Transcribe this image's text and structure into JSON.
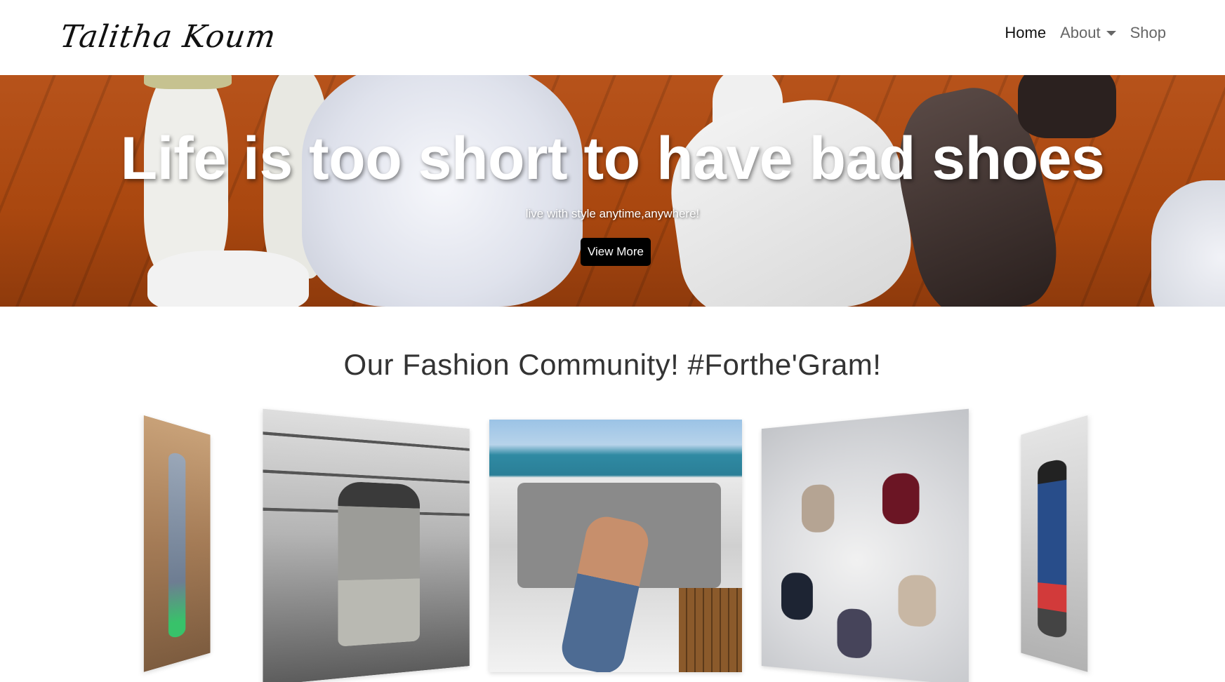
{
  "navbar": {
    "brand": "Talitha Koum",
    "links": [
      {
        "label": "Home",
        "active": true
      },
      {
        "label": "About",
        "has_dropdown": true
      },
      {
        "label": "Shop"
      }
    ]
  },
  "hero": {
    "title": "Life is too short to have bad shoes",
    "subtitle": "live with style anytime,anywhere!",
    "button_label": "View More"
  },
  "community": {
    "title": "Our Fashion Community! #Forthe'Gram!"
  },
  "colors": {
    "button_bg": "#000000",
    "hero_floor": "#a9470f",
    "nav_active": "#111111",
    "nav_inactive": "#666666"
  }
}
